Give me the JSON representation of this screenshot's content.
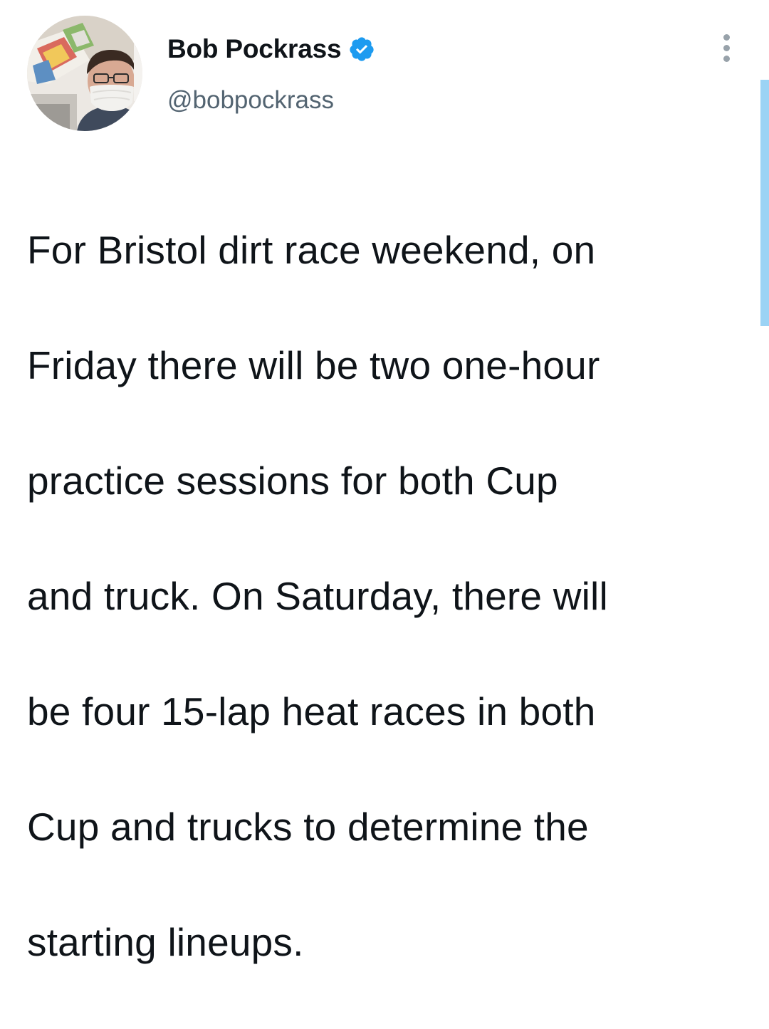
{
  "author": {
    "display_name": "Bob Pockrass",
    "handle": "@bobpockrass",
    "verified": true,
    "verified_badge_color": "#1d9bf0"
  },
  "tweet": {
    "text_lines": [
      "For Bristol dirt race weekend, on",
      "Friday there will be two one-hour",
      "practice sessions for both Cup",
      "and truck. On Saturday, there will",
      "be four 15-lap heat races in both",
      "Cup and trucks to determine the",
      "starting lineups."
    ]
  },
  "icons": {
    "avatar": "avatar-photo",
    "verified": "verified-badge-icon",
    "more": "more-options-icon"
  },
  "colors": {
    "text": "#0f1419",
    "handle": "#536471",
    "accent": "#1d9bf0",
    "scroll_indicator": "#9bd3f5"
  }
}
